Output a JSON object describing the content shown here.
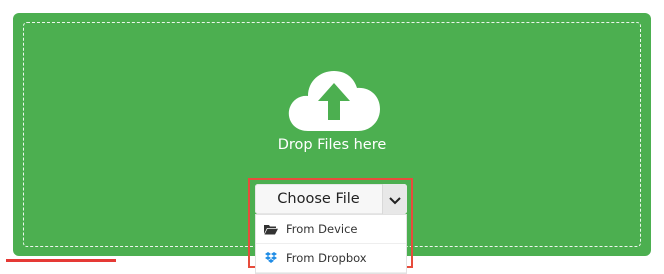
{
  "dropzone": {
    "text": "Drop Files here",
    "accent": "#4caf50",
    "icon": "cloud-upload-icon"
  },
  "choose_file": {
    "label": "Choose File",
    "caret_icon": "chevron-down-icon"
  },
  "menu": {
    "items": [
      {
        "label": "From Device",
        "icon": "folder-open-icon"
      },
      {
        "label": "From Dropbox",
        "icon": "dropbox-icon"
      }
    ]
  },
  "highlight_color": "#e74c3c"
}
